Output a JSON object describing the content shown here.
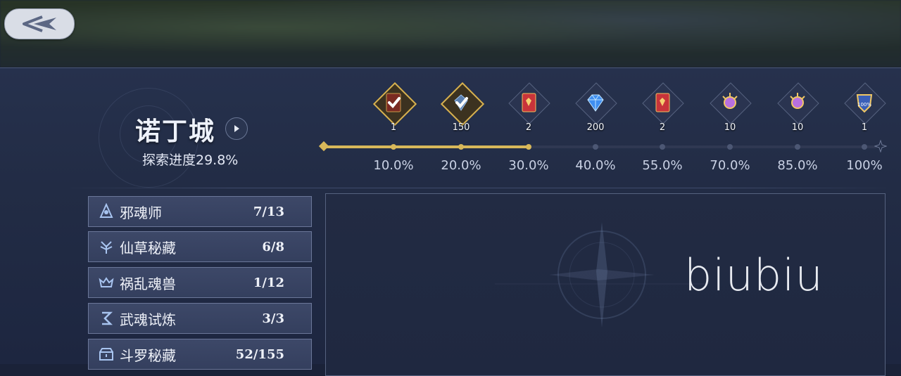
{
  "header": {
    "back_icon": "back-arrow-icon"
  },
  "city": {
    "name": "诺丁城",
    "progress_label": "探索进度29.8%",
    "progress_value": 0.298
  },
  "milestones": [
    {
      "pct": "10.0%",
      "count": "1",
      "icon": "book-icon",
      "claimed": true
    },
    {
      "pct": "20.0%",
      "count": "150",
      "icon": "crystal-icon",
      "claimed": true
    },
    {
      "pct": "30.0%",
      "count": "2",
      "icon": "red-tome-icon",
      "claimed": false
    },
    {
      "pct": "40.0%",
      "count": "200",
      "icon": "diamond-gem-icon",
      "claimed": false
    },
    {
      "pct": "55.0%",
      "count": "2",
      "icon": "red-tome-icon",
      "claimed": false
    },
    {
      "pct": "70.0%",
      "count": "10",
      "icon": "golden-orb-icon",
      "claimed": false
    },
    {
      "pct": "85.0%",
      "count": "10",
      "icon": "golden-orb-icon",
      "claimed": false
    },
    {
      "pct": "100%",
      "count": "1",
      "icon": "trophy-badge-icon",
      "claimed": false
    }
  ],
  "categories": [
    {
      "label": "邪魂师",
      "count": "7/13",
      "icon": "hooded-figure-icon"
    },
    {
      "label": "仙草秘藏",
      "count": "6/8",
      "icon": "herb-icon"
    },
    {
      "label": "祸乱魂兽",
      "count": "1/12",
      "icon": "beast-icon"
    },
    {
      "label": "武魂试炼",
      "count": "3/3",
      "icon": "scroll-icon"
    },
    {
      "label": "斗罗秘藏",
      "count": "52/155",
      "icon": "treasure-chest-icon"
    }
  ],
  "watermark": "biubiu",
  "colors": {
    "accent": "#d8b85a",
    "panel": "#26314d",
    "track": "#2f3852"
  }
}
